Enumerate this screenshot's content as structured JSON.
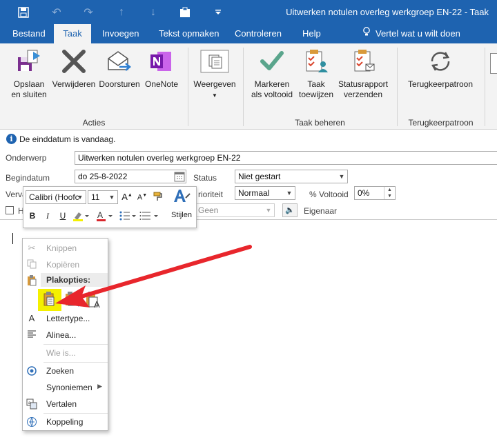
{
  "window": {
    "title": "Uitwerken notulen overleg werkgroep EN-22  -  Taak"
  },
  "tabs": [
    {
      "label": "Bestand"
    },
    {
      "label": "Taak"
    },
    {
      "label": "Invoegen"
    },
    {
      "label": "Tekst opmaken"
    },
    {
      "label": "Controleren"
    },
    {
      "label": "Help"
    }
  ],
  "tell_me": "Vertel wat u wilt doen",
  "ribbon": {
    "save_close": [
      "Opslaan",
      "en sluiten"
    ],
    "delete": "Verwijderen",
    "forward": "Doorsturen",
    "onenote": "OneNote",
    "view": "Weergeven",
    "mark_done": [
      "Markeren",
      "als voltooid"
    ],
    "assign": [
      "Taak",
      "toewijzen"
    ],
    "status_report": [
      "Statusrapport",
      "verzenden"
    ],
    "recurrence": "Terugkeerpatroon",
    "groups": {
      "actions": "Acties",
      "manage": "Taak beheren",
      "recurrence": "Terugkeerpatroon"
    }
  },
  "info": "De einddatum is vandaag.",
  "form": {
    "subject_label": "Onderwerp",
    "subject_value": "Uitwerken notulen overleg werkgroep EN-22",
    "start_label": "Begindatum",
    "start_value": "do 25-8-2022",
    "status_label": "Status",
    "status_value": "Niet gestart",
    "due_label_partial": "Verva",
    "priority_label_partial": "rioriteit",
    "priority_value": "Normaal",
    "pct_label": "% Voltooid",
    "pct_value": "0%",
    "reminder_partial": "H",
    "reminder_value": "Geen",
    "owner_label": "Eigenaar"
  },
  "mini_toolbar": {
    "font": "Calibri (Hoofc",
    "size": "11",
    "styles": "Stijlen",
    "bold": "B",
    "italic": "I",
    "underline": "U"
  },
  "context_menu": {
    "cut": "Knippen",
    "copy": "Kopiëren",
    "paste_options": "Plakopties:",
    "font": "Lettertype...",
    "paragraph": "Alinea...",
    "who_is": "Wie is...",
    "search": "Zoeken",
    "synonyms": "Synoniemen",
    "translate": "Vertalen",
    "link": "Koppeling"
  },
  "colors": {
    "brand": "#1e63b0",
    "arrow": "#e8262c",
    "highlight": "#f4f000"
  }
}
